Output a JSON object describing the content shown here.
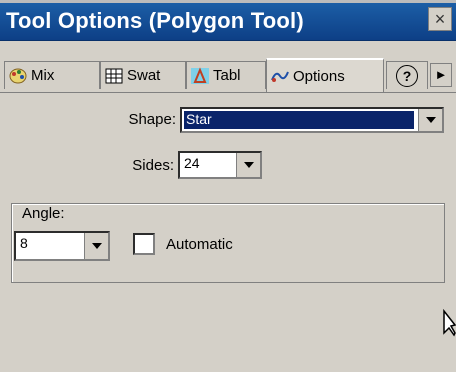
{
  "window": {
    "title": "Tool Options (Polygon Tool)",
    "close_glyph": "×"
  },
  "tabs": [
    {
      "label": "Mix",
      "icon": "palette-icon"
    },
    {
      "label": "Swat",
      "icon": "swatches-icon"
    },
    {
      "label": "Tabl",
      "icon": "table-icon"
    },
    {
      "label": "Options",
      "icon": "options-icon",
      "active": true
    },
    {
      "label": "?",
      "icon": "help-icon"
    }
  ],
  "nav": {
    "next_glyph": "►"
  },
  "shape": {
    "label": "Shape:",
    "value": "Star"
  },
  "sides": {
    "label": "Sides:",
    "value": "24"
  },
  "angle": {
    "group_label": "Angle:",
    "value": "8",
    "automatic_label": "Automatic",
    "automatic_checked": false
  },
  "colors": {
    "title_bar": "#0d3f86",
    "panel": "#d4d0c8",
    "selection": "#0a246a"
  }
}
